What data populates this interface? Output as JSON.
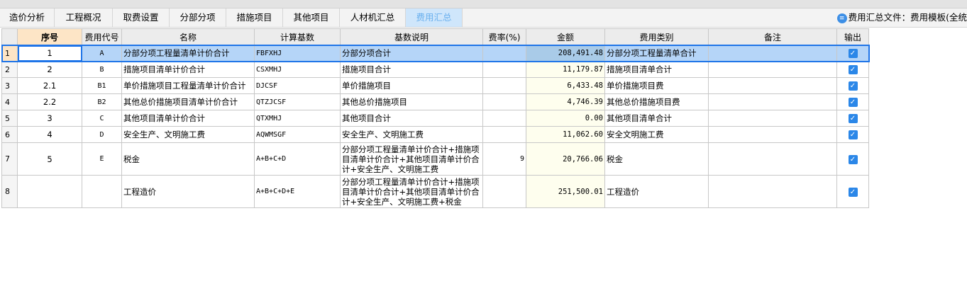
{
  "tabs": [
    {
      "label": "造价分析"
    },
    {
      "label": "工程概况"
    },
    {
      "label": "取费设置"
    },
    {
      "label": "分部分项"
    },
    {
      "label": "措施项目"
    },
    {
      "label": "其他项目"
    },
    {
      "label": "人材机汇总"
    },
    {
      "label": "费用汇总",
      "active": true
    }
  ],
  "file_label": "费用汇总文件：费用模板(全统",
  "columns": [
    "",
    "序号",
    "费用代号",
    "名称",
    "计算基数",
    "基数说明",
    "费率(%)",
    "金额",
    "费用类别",
    "备注",
    "输出"
  ],
  "rows": [
    {
      "row": "1",
      "seq": "1",
      "code": "A",
      "name": "分部分项工程量清单计价合计",
      "base": "FBFXHJ",
      "desc": "分部分项合计",
      "rate": "",
      "amount": "208,491.48",
      "category": "分部分项工程量清单合计",
      "note": "",
      "output": true
    },
    {
      "row": "2",
      "seq": "2",
      "code": "B",
      "name": "措施项目清单计价合计",
      "base": "CSXMHJ",
      "desc": "措施项目合计",
      "rate": "",
      "amount": "11,179.87",
      "category": "措施项目清单合计",
      "note": "",
      "output": true
    },
    {
      "row": "3",
      "seq": "2.1",
      "code": "B1",
      "name": "单价措施项目工程量清单计价合计",
      "base": "DJCSF",
      "desc": "单价措施项目",
      "rate": "",
      "amount": "6,433.48",
      "category": "单价措施项目费",
      "note": "",
      "output": true
    },
    {
      "row": "4",
      "seq": "2.2",
      "code": "B2",
      "name": "其他总价措施项目清单计价合计",
      "base": "QTZJCSF",
      "desc": "其他总价措施项目",
      "rate": "",
      "amount": "4,746.39",
      "category": "其他总价措施项目费",
      "note": "",
      "output": true
    },
    {
      "row": "5",
      "seq": "3",
      "code": "C",
      "name": "其他项目清单计价合计",
      "base": "QTXMHJ",
      "desc": "其他项目合计",
      "rate": "",
      "amount": "0.00",
      "category": "其他项目清单合计",
      "note": "",
      "output": true
    },
    {
      "row": "6",
      "seq": "4",
      "code": "D",
      "name": "安全生产、文明施工费",
      "base": "AQWMSGF",
      "desc": "安全生产、文明施工费",
      "rate": "",
      "amount": "11,062.60",
      "category": "安全文明施工费",
      "note": "",
      "output": true
    },
    {
      "row": "7",
      "seq": "5",
      "code": "E",
      "name": "税金",
      "base": "A+B+C+D",
      "desc": "分部分项工程量清单计价合计+措施项目清单计价合计+其他项目清单计价合计+安全生产、文明施工费",
      "rate": "9",
      "amount": "20,766.06",
      "category": "税金",
      "note": "",
      "output": true
    },
    {
      "row": "8",
      "seq": "",
      "code": "",
      "name": "工程造价",
      "base": "A+B+C+D+E",
      "desc": "分部分项工程量清单计价合计+措施项目清单计价合计+其他项目清单计价合计+安全生产、文明施工费+税金",
      "rate": "",
      "amount": "251,500.01",
      "category": "工程造价",
      "note": "",
      "output": true
    }
  ]
}
